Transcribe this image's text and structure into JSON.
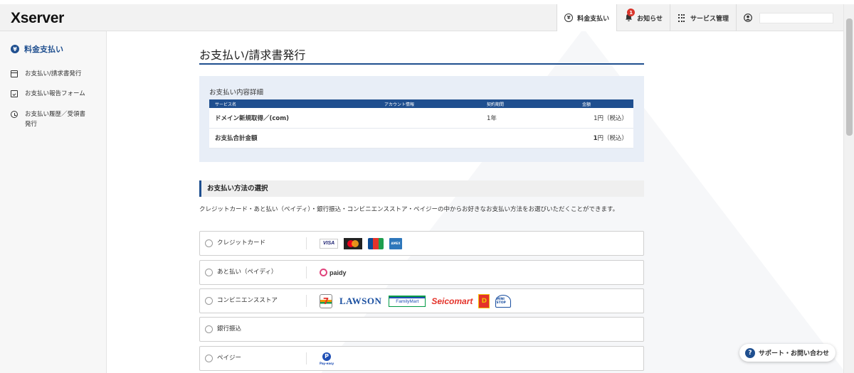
{
  "app": {
    "logo": "Xserver"
  },
  "header": {
    "nav": [
      {
        "label": "料金支払い",
        "icon": "yen-icon",
        "active": true
      },
      {
        "label": "お知らせ",
        "icon": "bell-icon",
        "badge": "1"
      },
      {
        "label": "サービス管理",
        "icon": "grid-icon"
      },
      {
        "label": "",
        "icon": "user-icon"
      }
    ],
    "yen_glyph": "¥"
  },
  "sidebar": {
    "section_title": "料金支払い",
    "section_icon_glyph": "¥",
    "items": [
      {
        "label": "お支払い/請求書発行",
        "icon": "card-icon"
      },
      {
        "label": "お支払い報告フォーム",
        "icon": "form-icon"
      },
      {
        "label": "お支払い履歴／受領書発行",
        "icon": "clock-icon"
      }
    ]
  },
  "main": {
    "title": "お支払い/請求書発行",
    "detail": {
      "title": "お支払い内容詳細",
      "columns": [
        "サービス名",
        "アカウント情報",
        "契約期間",
        "金額"
      ],
      "rows": [
        {
          "service": "ドメイン新規取得／(com)",
          "account": "",
          "period": "1年",
          "amount": "1円（税込）"
        }
      ],
      "total_label": "お支払合計金額",
      "total_amount_num": "1",
      "total_amount_suffix": "円（税込）"
    },
    "payment_section": {
      "heading": "お支払い方法の選択",
      "description": "クレジットカード・あと払い（ペイディ）・銀行振込・コンビニエンスストア・ペイジーの中からお好きなお支払い方法をお選びいただくことができます。",
      "methods": [
        {
          "label": "クレジットカード",
          "logos": [
            "VISA",
            "mastercard",
            "JCB",
            "AMERICAN EXPRESS"
          ]
        },
        {
          "label": "あと払い（ペイディ）",
          "logos": [
            "paidy"
          ]
        },
        {
          "label": "コンビニエンスストア",
          "logos": [
            "7",
            "LAWSON",
            "FamilyMart",
            "Seicomart",
            "D",
            "MINI STOP"
          ]
        },
        {
          "label": "銀行振込",
          "logos": []
        },
        {
          "label": "ペイジー",
          "logos": [
            "P",
            "Pay-easy"
          ]
        }
      ]
    }
  },
  "support": {
    "label": "サポート・お問い合わせ",
    "icon_glyph": "?"
  }
}
